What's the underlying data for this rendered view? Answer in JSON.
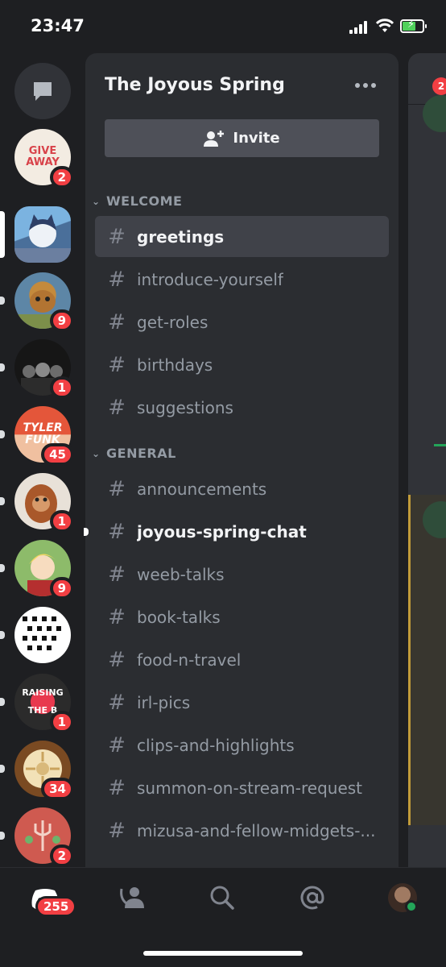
{
  "status_bar": {
    "time": "23:47"
  },
  "servers": [
    {
      "id": "giveaway",
      "art_text": "GIVE AWAY",
      "badge": "2",
      "unread_pill": false
    },
    {
      "id": "active-server",
      "art_text": "",
      "badge": "",
      "active": true
    },
    {
      "id": "server-3",
      "art_text": "",
      "badge": "9",
      "unread_pill": true
    },
    {
      "id": "server-4",
      "art_text": "",
      "badge": "1",
      "unread_pill": true
    },
    {
      "id": "tyler",
      "art_text": "TYLER FUNK",
      "badge": "45",
      "unread_pill": true
    },
    {
      "id": "orangutan",
      "art_text": "",
      "badge": "1",
      "unread_pill": true
    },
    {
      "id": "anime",
      "art_text": "",
      "badge": "9",
      "unread_pill": true
    },
    {
      "id": "letters",
      "art_text": "",
      "badge": "",
      "unread_pill": true
    },
    {
      "id": "raising",
      "art_text": "RAISING THE B",
      "badge": "1",
      "unread_pill": true
    },
    {
      "id": "plate",
      "art_text": "",
      "badge": "34",
      "unread_pill": true
    },
    {
      "id": "trident",
      "art_text": "",
      "badge": "2",
      "unread_pill": true
    }
  ],
  "server": {
    "name": "The Joyous Spring",
    "invite_label": "Invite"
  },
  "categories": [
    {
      "name": "WELCOME",
      "channels": [
        {
          "name": "greetings",
          "state": "selected"
        },
        {
          "name": "introduce-yourself",
          "state": "normal"
        },
        {
          "name": "get-roles",
          "state": "normal"
        },
        {
          "name": "birthdays",
          "state": "normal"
        },
        {
          "name": "suggestions",
          "state": "normal"
        }
      ]
    },
    {
      "name": "GENERAL",
      "channels": [
        {
          "name": "announcements",
          "state": "normal"
        },
        {
          "name": "joyous-spring-chat",
          "state": "unread"
        },
        {
          "name": "weeb-talks",
          "state": "normal"
        },
        {
          "name": "book-talks",
          "state": "normal"
        },
        {
          "name": "food-n-travel",
          "state": "normal"
        },
        {
          "name": "irl-pics",
          "state": "normal"
        },
        {
          "name": "clips-and-highlights",
          "state": "normal"
        },
        {
          "name": "summon-on-stream-request",
          "state": "normal"
        },
        {
          "name": "mizusa-and-fellow-midgets-...",
          "state": "normal"
        }
      ]
    }
  ],
  "chat_peek": {
    "header_badge": "2"
  },
  "tab_bar": {
    "home_badge": "255",
    "tabs": [
      "home",
      "friends",
      "search",
      "mentions",
      "profile"
    ]
  },
  "colors": {
    "background": "#1e1f22",
    "panel": "#2b2d31",
    "badge": "#f23f43",
    "online": "#23a559"
  }
}
